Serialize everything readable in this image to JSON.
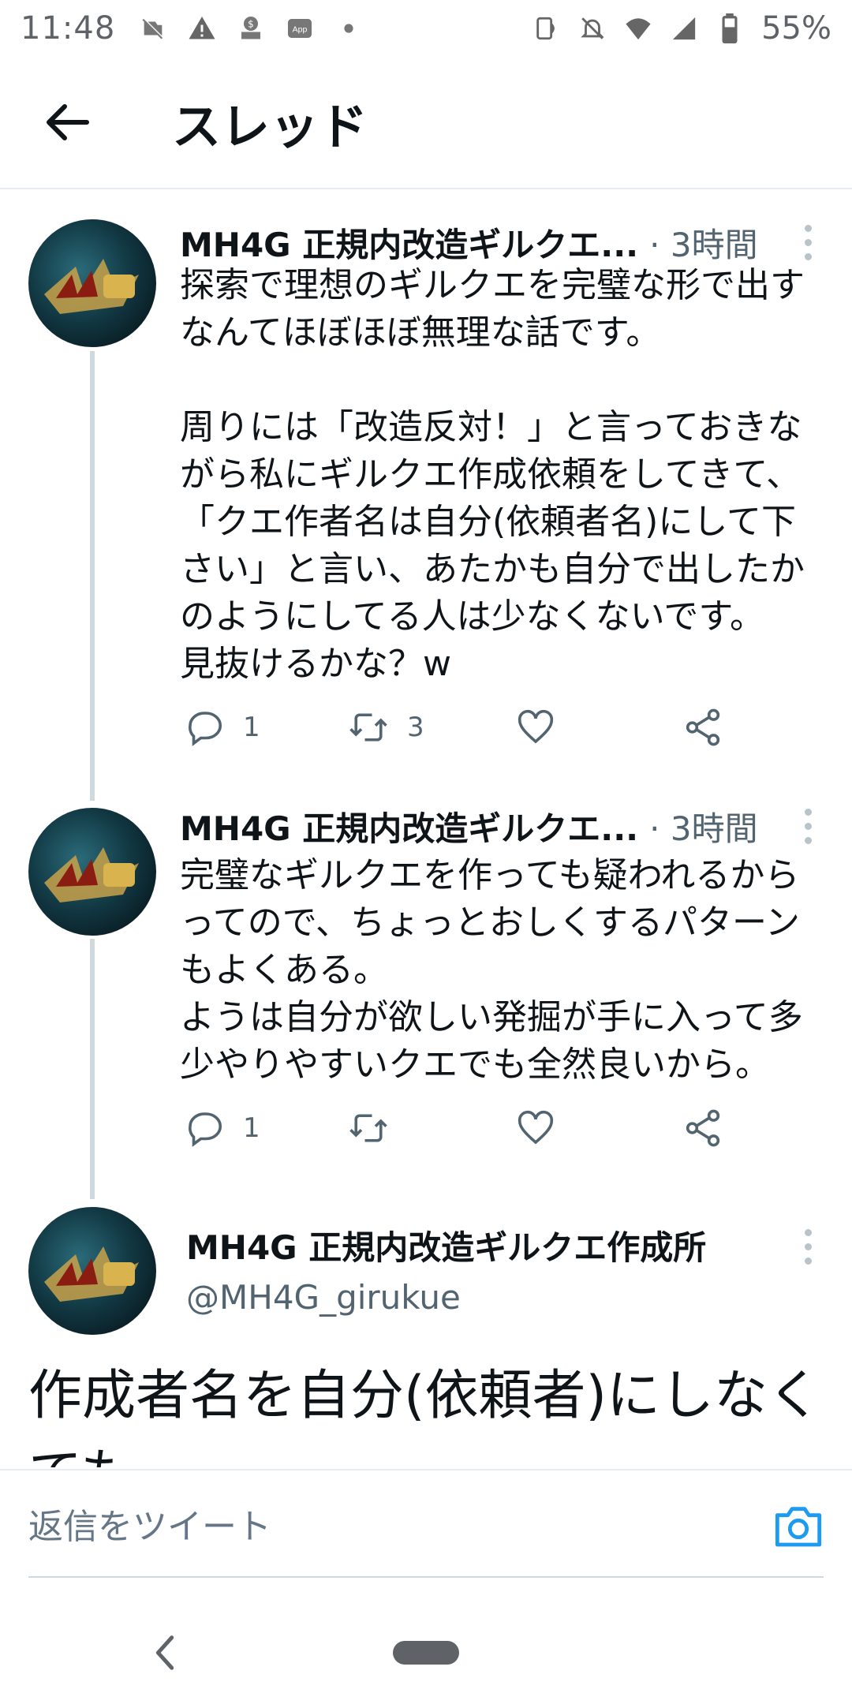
{
  "status_bar": {
    "time": "11:48",
    "left_icons": [
      "no-image-icon",
      "warning-icon",
      "cash-icon",
      "app-icon",
      "dot-icon"
    ],
    "app_label": "App",
    "right_icons": [
      "nfc-icon",
      "mute-icon",
      "wifi-icon",
      "cell-signal-icon",
      "battery-icon"
    ],
    "battery": "55%"
  },
  "header": {
    "title": "スレッド",
    "back_icon": "back-arrow-icon"
  },
  "tweets": [
    {
      "name": "MH4G 正規内改造ギルクエ...",
      "meta": "· 3時間",
      "text": "探索で理想のギルクエを完璧な形で出すなんてほぼほぼ無理な話です。\n\n周りには「改造反対！」と言っておきながら私にギルクエ作成依頼をしてきて、「クエ作者名は自分(依頼者名)にして下さい」と言い、あたかも自分で出したかのようにしてる人は少なくないです。\n見抜けるかな？w",
      "reply_count": "1",
      "retweet_count": "3"
    },
    {
      "name": "MH4G 正規内改造ギルクエ...",
      "meta": "· 3時間",
      "text": "完璧なギルクエを作っても疑われるからってので、ちょっとおしくするパターンもよくある。\nようは自分が欲しい発掘が手に入って多少やりやすいクエでも全然良いから。",
      "reply_count": "1",
      "retweet_count": ""
    }
  ],
  "main_tweet": {
    "name": "MH4G 正規内改造ギルクエ作成所",
    "handle": "@MH4G_girukue",
    "text": "作成者名を自分(依頼者)にしなくても"
  },
  "reply_bar": {
    "placeholder": "返信をツイート",
    "camera_icon": "camera-icon"
  },
  "colors": {
    "accent": "#1d9bf0",
    "secondary_text": "#536471",
    "divider": "#e6ecf0"
  }
}
